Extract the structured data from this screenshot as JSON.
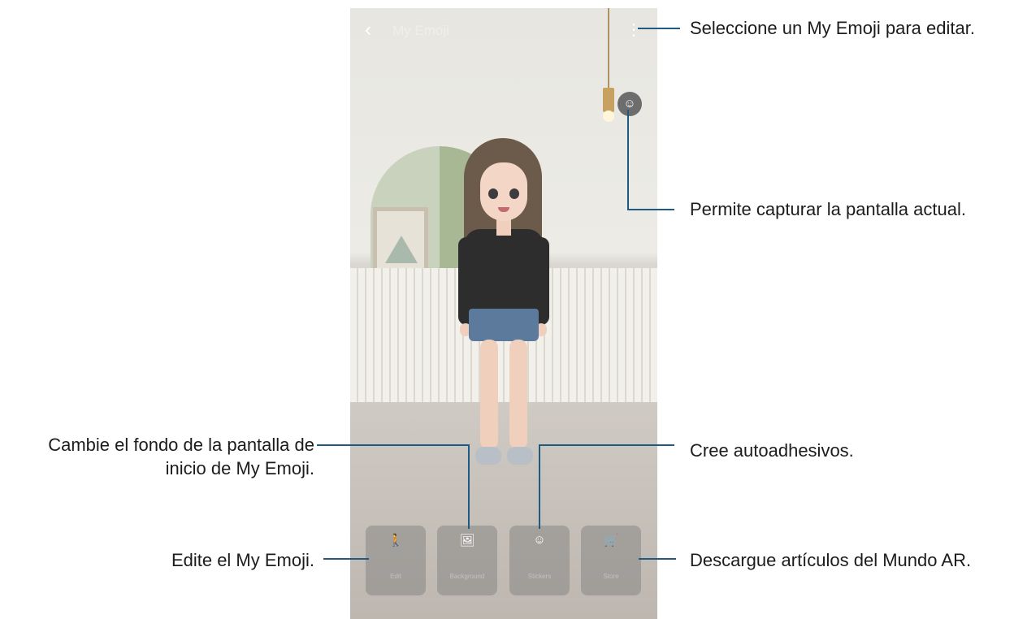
{
  "screen": {
    "title": "My Emoji",
    "back_icon": "chevron-left-icon",
    "more_icon": "more-vert-icon",
    "capture_icon": "face-capture-icon",
    "buttons": [
      {
        "label": "Edit",
        "icon": "person-icon",
        "glyph": "🚶"
      },
      {
        "label": "Background",
        "icon": "image-icon",
        "glyph": "🖼"
      },
      {
        "label": "Stickers",
        "icon": "sticker-icon",
        "glyph": "☺"
      },
      {
        "label": "Store",
        "icon": "cart-icon",
        "glyph": "🛒"
      }
    ]
  },
  "callouts": {
    "edit_select": "Seleccione un My Emoji para editar.",
    "capture": "Permite capturar la pantalla actual.",
    "background_line1": "Cambie el fondo de la pantalla de",
    "background_line2": "inicio de My Emoji.",
    "stickers": "Cree autoadhesivos.",
    "edit": "Edite el My Emoji.",
    "store": "Descargue artículos del Mundo AR."
  },
  "colors": {
    "callout_line": "#1f5a85"
  }
}
